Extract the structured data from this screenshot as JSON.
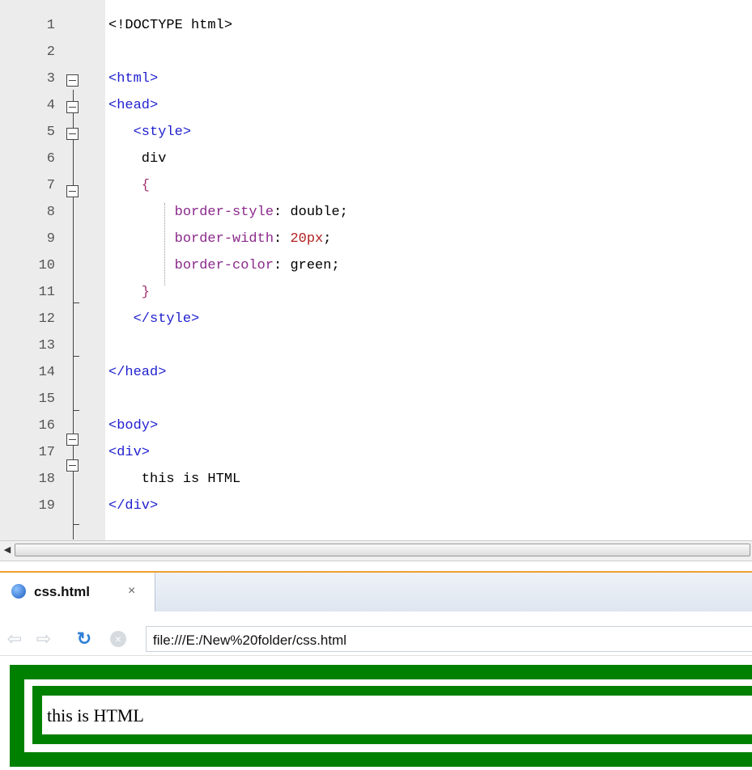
{
  "editor": {
    "lines": [
      {
        "n": "1",
        "segments": [
          {
            "text": "<!DOCTYPE html>",
            "cls": ""
          }
        ]
      },
      {
        "n": "2",
        "segments": []
      },
      {
        "n": "3",
        "segments": [
          {
            "text": "<html>",
            "cls": "tag"
          }
        ]
      },
      {
        "n": "4",
        "segments": [
          {
            "text": "<head>",
            "cls": "tag"
          }
        ]
      },
      {
        "n": "5",
        "segments": [
          {
            "text": "   <style>",
            "cls": "tag"
          }
        ]
      },
      {
        "n": "6",
        "segments": [
          {
            "text": "    div",
            "cls": ""
          }
        ]
      },
      {
        "n": "7",
        "segments": [
          {
            "text": "    {",
            "cls": "brace"
          }
        ]
      },
      {
        "n": "8",
        "segments": [
          {
            "text": "        border-style",
            "cls": "prop"
          },
          {
            "text": ": double;",
            "cls": ""
          }
        ]
      },
      {
        "n": "9",
        "segments": [
          {
            "text": "        border-width",
            "cls": "prop"
          },
          {
            "text": ": ",
            "cls": ""
          },
          {
            "text": "20px",
            "cls": "num"
          },
          {
            "text": ";",
            "cls": ""
          }
        ]
      },
      {
        "n": "10",
        "segments": [
          {
            "text": "        border-color",
            "cls": "prop"
          },
          {
            "text": ": green;",
            "cls": ""
          }
        ]
      },
      {
        "n": "11",
        "segments": [
          {
            "text": "    }",
            "cls": "brace"
          }
        ]
      },
      {
        "n": "12",
        "segments": [
          {
            "text": "   </style>",
            "cls": "tag"
          }
        ]
      },
      {
        "n": "13",
        "segments": []
      },
      {
        "n": "14",
        "segments": [
          {
            "text": "</head>",
            "cls": "tag"
          }
        ]
      },
      {
        "n": "15",
        "segments": []
      },
      {
        "n": "16",
        "segments": [
          {
            "text": "<body>",
            "cls": "tag"
          }
        ]
      },
      {
        "n": "17",
        "segments": [
          {
            "text": "<div>",
            "cls": "tag"
          }
        ]
      },
      {
        "n": "18",
        "segments": [
          {
            "text": "    this is HTML",
            "cls": ""
          }
        ]
      },
      {
        "n": "19",
        "segments": [
          {
            "text": "</div>",
            "cls": "tag"
          }
        ]
      }
    ]
  },
  "browser": {
    "tab_title": "css.html",
    "tab_close": "×",
    "url": "file:///E:/New%20folder/css.html",
    "page_text": "this is HTML"
  },
  "colors": {
    "border": "#008000",
    "tag": "#1f1fd0",
    "property": "#8b2a8b",
    "number": "#b22222"
  }
}
